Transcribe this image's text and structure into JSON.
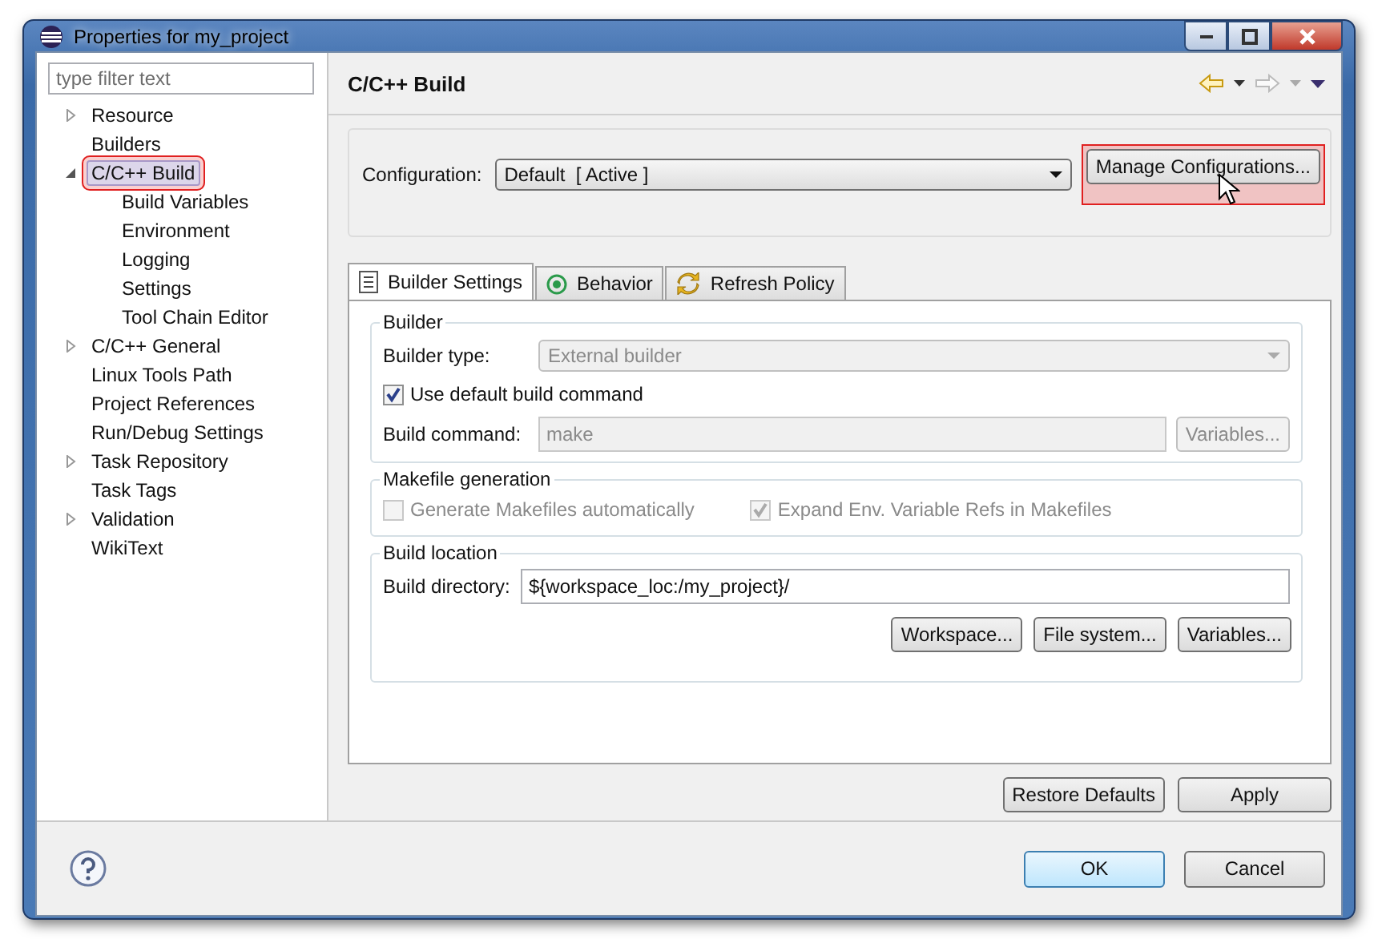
{
  "window": {
    "title": "Properties for my_project"
  },
  "filter": {
    "placeholder": "type filter text"
  },
  "tree": [
    {
      "label": "Resource",
      "expanded": false,
      "selected": false
    },
    {
      "label": "Builders",
      "selected": false
    },
    {
      "label": "C/C++ Build",
      "expanded": true,
      "selected": true,
      "highlighted": true,
      "children": [
        {
          "label": "Build Variables",
          "selected": false
        },
        {
          "label": "Environment",
          "selected": false
        },
        {
          "label": "Logging",
          "selected": false
        },
        {
          "label": "Settings",
          "selected": false
        },
        {
          "label": "Tool Chain Editor",
          "selected": false
        }
      ]
    },
    {
      "label": "C/C++ General",
      "expanded": false,
      "selected": false
    },
    {
      "label": "Linux Tools Path",
      "selected": false
    },
    {
      "label": "Project References",
      "selected": false
    },
    {
      "label": "Run/Debug Settings",
      "selected": false
    },
    {
      "label": "Task Repository",
      "expanded": false,
      "selected": false
    },
    {
      "label": "Task Tags",
      "selected": false
    },
    {
      "label": "Validation",
      "expanded": false,
      "selected": false
    },
    {
      "label": "WikiText",
      "selected": false
    }
  ],
  "page": {
    "title": "C/C++ Build"
  },
  "configuration": {
    "label": "Configuration:",
    "value": "Default  [ Active ]",
    "button": "Manage Configurations...",
    "button_highlighted": true
  },
  "tabs": [
    {
      "label": "Builder Settings",
      "kind": "list",
      "selected": true
    },
    {
      "label": "Behavior",
      "kind": "target",
      "selected": false
    },
    {
      "label": "Refresh Policy",
      "kind": "refresh",
      "selected": false
    }
  ],
  "builder": {
    "title": "Builder",
    "type_label": "Builder type:",
    "type_value": "External builder",
    "use_default_label": "Use default build command",
    "use_default_checked": true,
    "command_label": "Build command:",
    "command_value": "make",
    "variables_button": "Variables..."
  },
  "makefile": {
    "title": "Makefile generation",
    "options": [
      {
        "label": "Generate Makefiles automatically",
        "checked": false,
        "disabled": true
      },
      {
        "label": "Expand Env. Variable Refs in Makefiles",
        "checked": true,
        "disabled": true
      }
    ]
  },
  "location": {
    "title": "Build location",
    "dir_label": "Build directory:",
    "dir_value": "${workspace_loc:/my_project}/",
    "buttons": [
      "Workspace...",
      "File system...",
      "Variables..."
    ]
  },
  "page_buttons": [
    "Restore Defaults",
    "Apply"
  ],
  "dialog_buttons": [
    {
      "label": "OK",
      "default": true
    },
    {
      "label": "Cancel",
      "default": false
    }
  ]
}
